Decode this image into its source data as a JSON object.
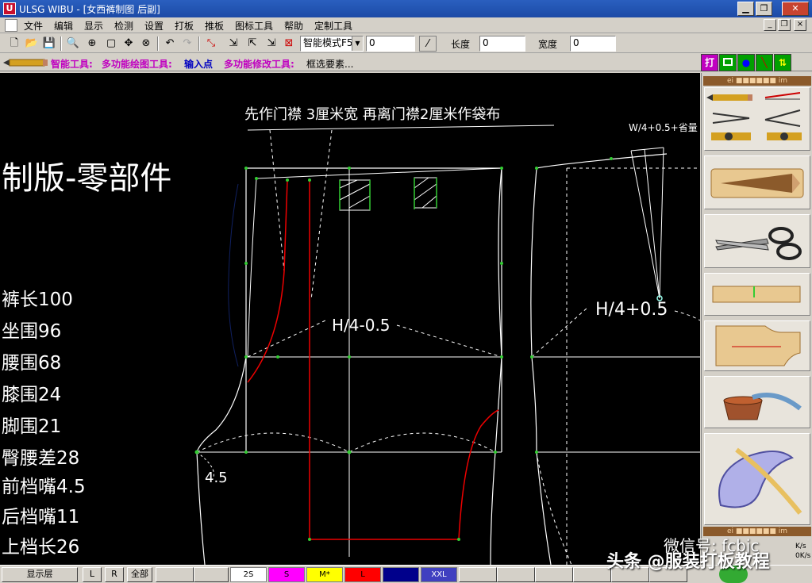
{
  "window": {
    "title": "ULSG WIBU - [女西裤制图 后副]",
    "minimize_glyph": "▁",
    "restore_glyph": "❐",
    "close_glyph": "✕"
  },
  "menu": {
    "items": [
      "文件",
      "编辑",
      "显示",
      "检测",
      "设置",
      "打板",
      "推板",
      "图标工具",
      "帮助",
      "定制工具"
    ],
    "mdi_minimize": "_",
    "mdi_restore": "❐",
    "mdi_close": "×"
  },
  "toolbar": {
    "icons": [
      "new-file-icon",
      "open-folder-icon",
      "save-icon",
      "zoom-out-icon",
      "zoom-in-icon",
      "zoom-window-icon",
      "pan-icon",
      "zoom-fit-icon",
      "undo-icon",
      "redo-icon",
      "select-tool-icon",
      "point-tool-1-icon",
      "point-tool-2-icon",
      "point-tool-3-icon",
      "point-tool-4-icon"
    ],
    "mode_select": "智能模式F5",
    "angle_value": "0",
    "length_label": "长度",
    "length_value": "0",
    "width_label": "宽度",
    "width_value": "0"
  },
  "statusline": {
    "smart_tool": "智能工具:",
    "multi_draw": "多功能绘图工具:",
    "input_point": "输入点",
    "multi_modify": "多功能修改工具:",
    "action": "框选要素..."
  },
  "tool_tabs": {
    "da": "打"
  },
  "canvas": {
    "instruction": "先作门襟  3厘米宽  再离门襟2厘米作袋布",
    "dart_note": "W/4+0.5+省量",
    "heading": "制版-零部件",
    "front_hip": "H/4-0.5",
    "back_hip": "H/4+0.5",
    "crotch_ext": "4.5",
    "measurements": [
      "裤长100",
      "坐围96",
      "腰围68",
      "膝围24",
      "脚围21",
      "臀腰差28",
      "前档嘴4.5",
      "后档嘴11",
      "上档长26"
    ]
  },
  "right_panel": {
    "header_top": "ei ■■■■■■ im",
    "header_bottom": "ei ■■■■■■ im"
  },
  "bottom": {
    "layer_button": "显示层",
    "l_button": "L",
    "r_button": "R",
    "all_button": "全部",
    "sizes": [
      "2S",
      "S",
      "M*",
      "L",
      "",
      "XXL"
    ],
    "size_colors": [
      "#ffffff",
      "#ff00ff",
      "#ffff00",
      "#ff0000",
      "#00008b",
      "#4040c0"
    ],
    "speed_top": "K/s",
    "speed_bottom": "0K/s"
  },
  "watermark": {
    "wechat": "微信号: fcbjc",
    "toutiao": "头条 @服装打板教程"
  }
}
